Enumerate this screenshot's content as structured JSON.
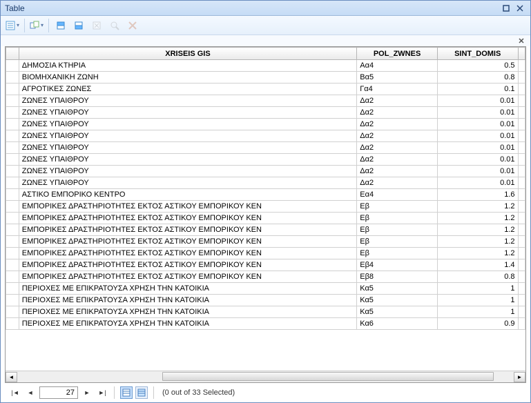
{
  "window": {
    "title": "Table"
  },
  "columns": {
    "xriseis": "XRISEIS GIS",
    "pol": "POL_ZWNES",
    "sint": "SINT_DOMIS"
  },
  "rows": [
    {
      "xr": "ΔΗΜΟΣΙΑ ΚΤΗΡΙΑ",
      "pol": "Αα4",
      "sint": "0.5"
    },
    {
      "xr": "ΒΙΟΜΗΧΑΝΙΚΗ ΖΩΝΗ",
      "pol": "Βα5",
      "sint": "0.8"
    },
    {
      "xr": "ΑΓΡΟΤΙΚΕΣ ΖΩΝΕΣ",
      "pol": "Γα4",
      "sint": "0.1"
    },
    {
      "xr": "ΖΩΝΕΣ ΥΠΑΙΘΡΟΥ",
      "pol": "Δα2",
      "sint": "0.01"
    },
    {
      "xr": "ΖΩΝΕΣ ΥΠΑΙΘΡΟΥ",
      "pol": "Δα2",
      "sint": "0.01"
    },
    {
      "xr": "ΖΩΝΕΣ ΥΠΑΙΘΡΟΥ",
      "pol": "Δα2",
      "sint": "0.01"
    },
    {
      "xr": "ΖΩΝΕΣ ΥΠΑΙΘΡΟΥ",
      "pol": "Δα2",
      "sint": "0.01"
    },
    {
      "xr": "ΖΩΝΕΣ ΥΠΑΙΘΡΟΥ",
      "pol": "Δα2",
      "sint": "0.01"
    },
    {
      "xr": "ΖΩΝΕΣ ΥΠΑΙΘΡΟΥ",
      "pol": "Δα2",
      "sint": "0.01"
    },
    {
      "xr": "ΖΩΝΕΣ ΥΠΑΙΘΡΟΥ",
      "pol": "Δα2",
      "sint": "0.01"
    },
    {
      "xr": "ΖΩΝΕΣ ΥΠΑΙΘΡΟΥ",
      "pol": "Δα2",
      "sint": "0.01"
    },
    {
      "xr": "ΑΣΤΙΚΟ ΕΜΠΟΡΙΚΟ ΚΕΝΤΡΟ",
      "pol": "Εα4",
      "sint": "1.6"
    },
    {
      "xr": "ΕΜΠΟΡΙΚΕΣ ΔΡΑΣΤΗΡΙΟΤΗΤΕΣ ΕΚΤΟΣ ΑΣΤΙΚΟΥ ΕΜΠΟΡΙΚΟΥ ΚΕΝ",
      "pol": "Εβ",
      "sint": "1.2"
    },
    {
      "xr": "ΕΜΠΟΡΙΚΕΣ ΔΡΑΣΤΗΡΙΟΤΗΤΕΣ ΕΚΤΟΣ ΑΣΤΙΚΟΥ ΕΜΠΟΡΙΚΟΥ ΚΕΝ",
      "pol": "Εβ",
      "sint": "1.2"
    },
    {
      "xr": "ΕΜΠΟΡΙΚΕΣ ΔΡΑΣΤΗΡΙΟΤΗΤΕΣ ΕΚΤΟΣ ΑΣΤΙΚΟΥ ΕΜΠΟΡΙΚΟΥ ΚΕΝ",
      "pol": "Εβ",
      "sint": "1.2"
    },
    {
      "xr": "ΕΜΠΟΡΙΚΕΣ ΔΡΑΣΤΗΡΙΟΤΗΤΕΣ ΕΚΤΟΣ ΑΣΤΙΚΟΥ ΕΜΠΟΡΙΚΟΥ ΚΕΝ",
      "pol": "Εβ",
      "sint": "1.2"
    },
    {
      "xr": "ΕΜΠΟΡΙΚΕΣ ΔΡΑΣΤΗΡΙΟΤΗΤΕΣ ΕΚΤΟΣ ΑΣΤΙΚΟΥ ΕΜΠΟΡΙΚΟΥ ΚΕΝ",
      "pol": "Εβ",
      "sint": "1.2"
    },
    {
      "xr": "ΕΜΠΟΡΙΚΕΣ ΔΡΑΣΤΗΡΙΟΤΗΤΕΣ ΕΚΤΟΣ ΑΣΤΙΚΟΥ ΕΜΠΟΡΙΚΟΥ ΚΕΝ",
      "pol": "Εβ4",
      "sint": "1.4"
    },
    {
      "xr": "ΕΜΠΟΡΙΚΕΣ ΔΡΑΣΤΗΡΙΟΤΗΤΕΣ ΕΚΤΟΣ ΑΣΤΙΚΟΥ ΕΜΠΟΡΙΚΟΥ ΚΕΝ",
      "pol": "Εβ8",
      "sint": "0.8"
    },
    {
      "xr": "ΠΕΡΙΟΧΕΣ ΜΕ ΕΠΙΚΡΑΤΟΥΣΑ ΧΡΗΣΗ ΤΗΝ ΚΑΤΟΙΚΙΑ",
      "pol": "Κα5",
      "sint": "1"
    },
    {
      "xr": "ΠΕΡΙΟΧΕΣ ΜΕ ΕΠΙΚΡΑΤΟΥΣΑ ΧΡΗΣΗ ΤΗΝ ΚΑΤΟΙΚΙΑ",
      "pol": "Κα5",
      "sint": "1"
    },
    {
      "xr": "ΠΕΡΙΟΧΕΣ ΜΕ ΕΠΙΚΡΑΤΟΥΣΑ ΧΡΗΣΗ ΤΗΝ ΚΑΤΟΙΚΙΑ",
      "pol": "Κα5",
      "sint": "1"
    },
    {
      "xr": "ΠΕΡΙΟΧΕΣ ΜΕ ΕΠΙΚΡΑΤΟΥΣΑ ΧΡΗΣΗ ΤΗΝ ΚΑΤΟΙΚΙΑ",
      "pol": "Κα6",
      "sint": "0.9"
    }
  ],
  "footer": {
    "page": "27",
    "status": "(0 out of 33 Selected)"
  }
}
